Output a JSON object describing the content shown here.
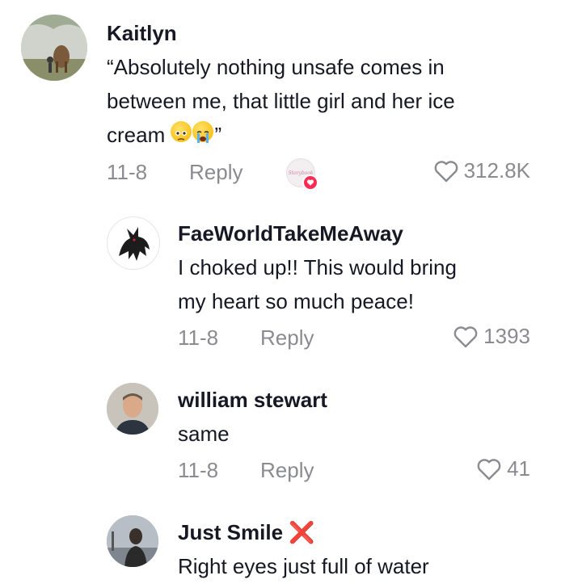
{
  "comments": [
    {
      "username": "Kaitlyn",
      "text_line1": "“Absolutely nothing unsafe comes in",
      "text_line2": "between me, that little girl and her ice",
      "text_line3": "cream",
      "text_quote_end": "”",
      "date": "11-8",
      "reply_label": "Reply",
      "likes": "312.8K",
      "creator_liked_label": "Storybook"
    },
    {
      "username": "FaeWorldTakeMeAway",
      "text_line1": "I choked up!! This would bring",
      "text_line2": "my heart so much peace!",
      "date": "11-8",
      "reply_label": "Reply",
      "likes": "1393"
    },
    {
      "username": "william stewart",
      "text_line1": "same",
      "date": "11-8",
      "reply_label": "Reply",
      "likes": "41"
    },
    {
      "username": "Just Smile",
      "username_badge": "❌",
      "text_line1": "Right eyes just full of water"
    }
  ],
  "colors": {
    "text_primary": "#161823",
    "text_secondary": "#8a8b91",
    "accent_red": "#fe2c55"
  }
}
